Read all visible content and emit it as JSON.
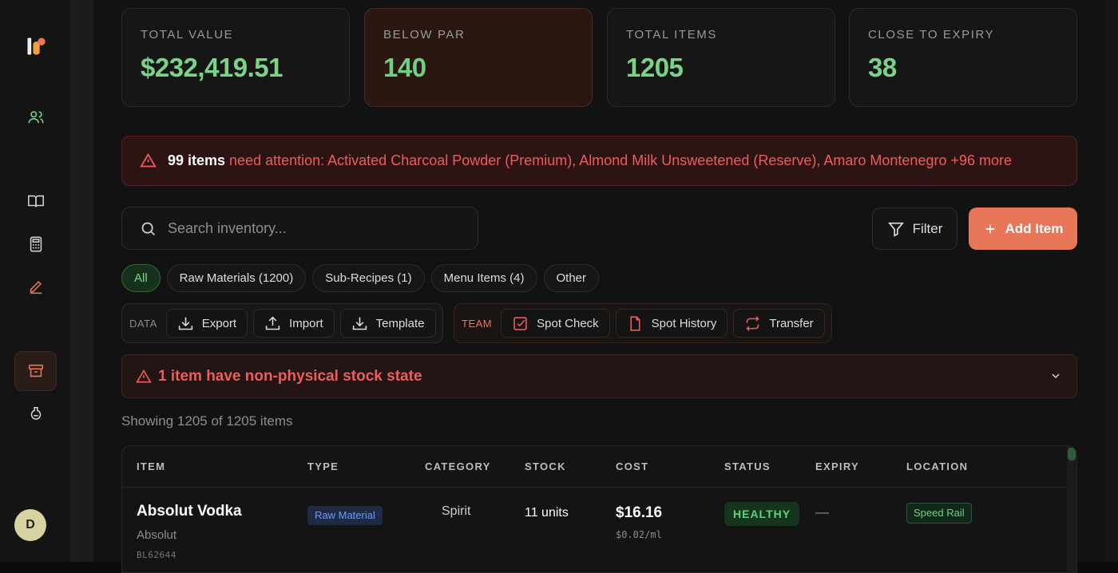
{
  "sidebar": {
    "logo": "brand-logo",
    "icons": [
      "users-icon",
      "book-icon",
      "calculator-icon",
      "pencil-icon",
      "archive-icon",
      "flask-icon"
    ],
    "user_initial": "D"
  },
  "stats": [
    {
      "label": "TOTAL VALUE",
      "value": "$232,419.51"
    },
    {
      "label": "BELOW PAR",
      "value": "140"
    },
    {
      "label": "TOTAL ITEMS",
      "value": "1205"
    },
    {
      "label": "CLOSE TO EXPIRY",
      "value": "38"
    }
  ],
  "alert": {
    "count": "99 items",
    "message": "need attention: Activated Charcoal Powder (Premium), Almond Milk Unsweetened (Reserve), Amaro Montenegro +96 more"
  },
  "search": {
    "placeholder": "Search inventory..."
  },
  "actions": {
    "filter_label": "Filter",
    "add_label": "Add Item"
  },
  "tabs": [
    "All",
    "Raw Materials (1200)",
    "Sub-Recipes (1)",
    "Menu Items (4)",
    "Other"
  ],
  "data_group": {
    "label": "DATA",
    "buttons": [
      "Export",
      "Import",
      "Template"
    ]
  },
  "team_group": {
    "label": "TEAM",
    "buttons": [
      "Spot Check",
      "Spot History",
      "Transfer"
    ]
  },
  "nonphysical": {
    "text": "1 item have non-physical stock state"
  },
  "showing": "Showing 1205 of 1205 items",
  "table": {
    "columns": [
      "ITEM",
      "TYPE",
      "CATEGORY",
      "STOCK",
      "COST",
      "STATUS",
      "EXPIRY",
      "LOCATION"
    ],
    "rows": [
      {
        "name": "Absolut Vodka",
        "brand": "Absolut",
        "sku": "BL62644",
        "type": "Raw Material",
        "category": "Spirit",
        "stock": "11 units",
        "cost": "$16.16",
        "unit_cost": "$0.02/ml",
        "status": "HEALTHY",
        "expiry": "—",
        "location": "Speed Rail"
      }
    ]
  },
  "colors": {
    "accent": "#e8775a",
    "positive": "#7bd389",
    "danger": "#ef5b5b"
  }
}
